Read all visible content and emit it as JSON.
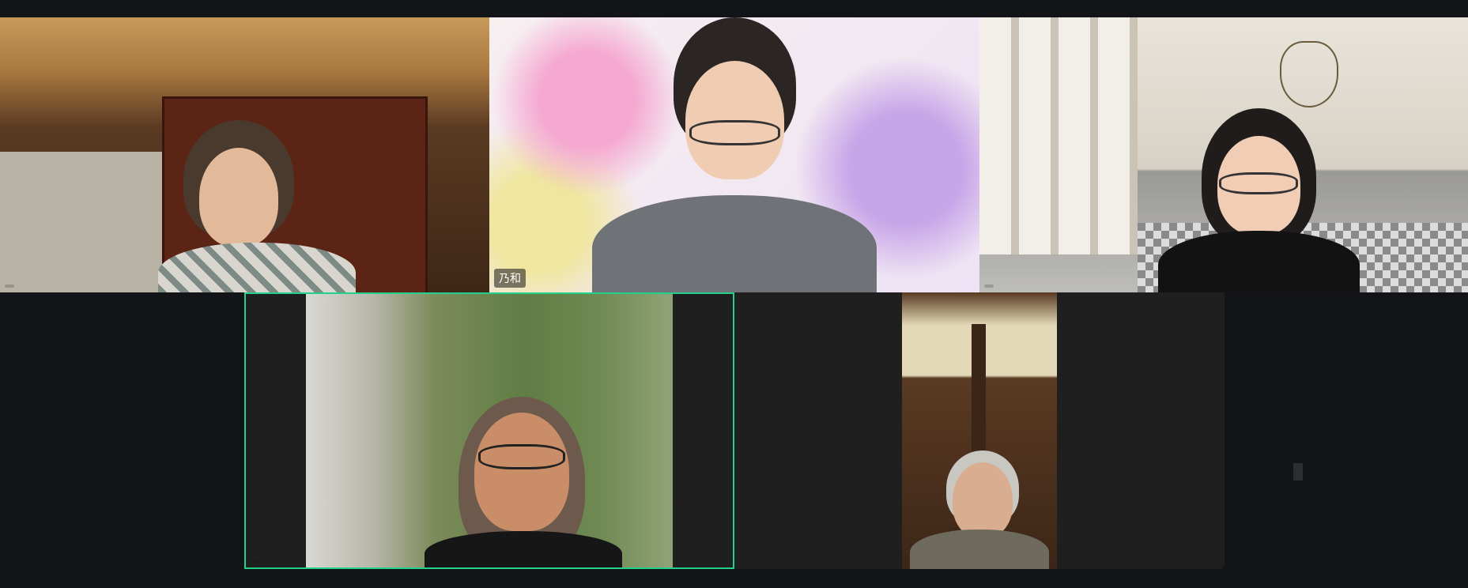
{
  "meeting": {
    "participants": [
      {
        "id": "p1",
        "name": "",
        "active": false
      },
      {
        "id": "p2",
        "name": "乃和",
        "active": false
      },
      {
        "id": "p3",
        "name": "",
        "active": false
      },
      {
        "id": "p4",
        "name": "",
        "active": true
      },
      {
        "id": "p5",
        "name": "",
        "active": false
      }
    ]
  },
  "colors": {
    "background": "#121417",
    "tile": "#1f1f1f",
    "active_border": "#23d18b",
    "name_tag_text": "#ffffff"
  }
}
